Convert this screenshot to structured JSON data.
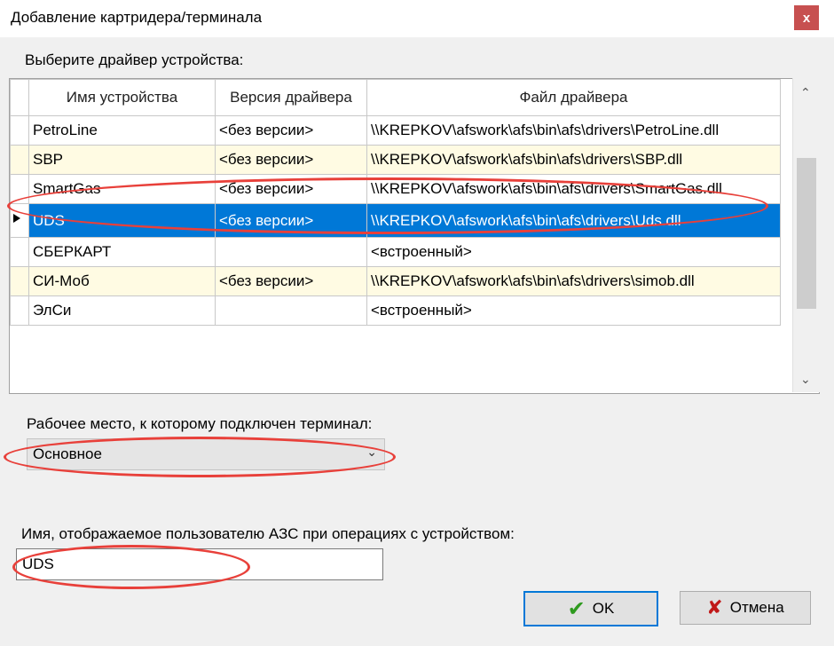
{
  "window": {
    "title": "Добавление картридера/терминала",
    "close_label": "x"
  },
  "driver_section": {
    "label": "Выберите драйвер устройства:",
    "columns": [
      "Имя устройства",
      "Версия драйвера",
      "Файл драйвера"
    ],
    "rows": [
      {
        "name": "PetroLine",
        "version": "<без версии>",
        "file": "\\\\KREPKOV\\afswork\\afs\\bin\\afs\\drivers\\PetroLine.dll"
      },
      {
        "name": "SBP",
        "version": "<без версии>",
        "file": "\\\\KREPKOV\\afswork\\afs\\bin\\afs\\drivers\\SBP.dll"
      },
      {
        "name": "SmartGas",
        "version": "<без версии>",
        "file": "\\\\KREPKOV\\afswork\\afs\\bin\\afs\\drivers\\SmartGas.dll"
      },
      {
        "name": "UDS",
        "version": "<без версии>",
        "file": "\\\\KREPKOV\\afswork\\afs\\bin\\afs\\drivers\\Uds.dll"
      },
      {
        "name": "СБЕРКАРТ",
        "version": "",
        "file": "<встроенный>"
      },
      {
        "name": "СИ-Моб",
        "version": "<без версии>",
        "file": "\\\\KREPKOV\\afswork\\afs\\bin\\afs\\drivers\\simob.dll"
      },
      {
        "name": "ЭлСи",
        "version": "",
        "file": "<встроенный>"
      }
    ],
    "selected_row": 3
  },
  "workplace": {
    "label": "Рабочее место, к которому подключен терминал:",
    "value": "Основное"
  },
  "display_name": {
    "label": "Имя, отображаемое пользователю АЗС при операциях с устройством:",
    "value": "UDS"
  },
  "buttons": {
    "ok": "OK",
    "cancel": "Отмена"
  },
  "colors": {
    "selection": "#0078d7",
    "alt_row": "#fffbe3",
    "annotation": "#e8403a"
  }
}
